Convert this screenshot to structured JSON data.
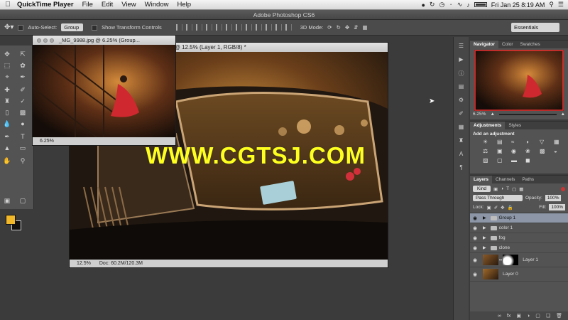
{
  "menubar": {
    "app_name": "QuickTime Player",
    "items": [
      "File",
      "Edit",
      "View",
      "Window",
      "Help"
    ],
    "clock": "Fri Jan 25  8:19 AM"
  },
  "photoshop": {
    "title": "Adobe Photoshop CS6",
    "options": {
      "auto_select_label": "Auto-Select:",
      "auto_select_value": "Group",
      "transform_label": "Show Transform Controls",
      "mode_3d": "3D Mode:",
      "workspace": "Essentials"
    },
    "docs": [
      {
        "title": "_MG_9988.jpg @ 6.25% (Group...",
        "zoom": "6.25%"
      },
      {
        "title": "_MG_9740.jpg @ 12.5% (Layer 1, RGB/8) *",
        "zoom": "12.5%",
        "doc_info": "Doc: 60.2M/120.3M"
      }
    ],
    "navigator": {
      "tabs": [
        "Navigator",
        "Color",
        "Swatches"
      ],
      "zoom": "6.25%"
    },
    "adjustments": {
      "tabs": [
        "Adjustments",
        "Styles"
      ],
      "heading": "Add an adjustment"
    },
    "layers": {
      "tabs": [
        "Layers",
        "Channels",
        "Paths"
      ],
      "kind": "Kind",
      "blend": "Pass Through",
      "opacity_label": "Opacity:",
      "opacity": "100%",
      "lock_label": "Lock:",
      "fill_label": "Fill:",
      "fill": "100%",
      "items": [
        {
          "name": "Group 1",
          "type": "group",
          "selected": true
        },
        {
          "name": "color 1",
          "type": "group",
          "selected": false
        },
        {
          "name": "fog",
          "type": "group",
          "selected": false
        },
        {
          "name": "clone",
          "type": "group",
          "selected": false
        },
        {
          "name": "Layer 1",
          "type": "masked",
          "selected": false
        },
        {
          "name": "Layer 0",
          "type": "image",
          "selected": false
        }
      ]
    }
  },
  "watermark": "WWW.CGTSJ.COM",
  "colors": {
    "foreground": "#f1b829",
    "background": "#111111",
    "selection": "#8c96a6"
  }
}
